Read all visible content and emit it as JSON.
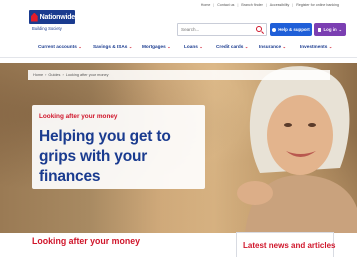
{
  "utility_links": [
    "Home",
    "Contact us",
    "Branch finder",
    "Accessibility",
    "Register for online banking"
  ],
  "logo": {
    "name": "Nationwide",
    "sub": "Building Society"
  },
  "search": {
    "placeholder": "Search..."
  },
  "buttons": {
    "help": "Help & support",
    "login": "Log in"
  },
  "nav": [
    {
      "label": "Current accounts"
    },
    {
      "label": "Savings & ISAs"
    },
    {
      "label": "Mortgages"
    },
    {
      "label": "Loans"
    },
    {
      "label": "Credit cards"
    },
    {
      "label": "Insurance"
    },
    {
      "label": "Investments"
    }
  ],
  "breadcrumb": [
    "Home",
    "Guides",
    "Looking after your money"
  ],
  "hero": {
    "kicker": "Looking after your money",
    "title": "Helping you get to grips with your finances"
  },
  "section": {
    "heading": "Looking after your money"
  },
  "news": {
    "title": "Latest news and articles"
  },
  "colors": {
    "brand_blue": "#1a3b8f",
    "accent_red": "#d0162b",
    "help_blue": "#1f5fd8",
    "login_purple": "#7b3fb2"
  }
}
